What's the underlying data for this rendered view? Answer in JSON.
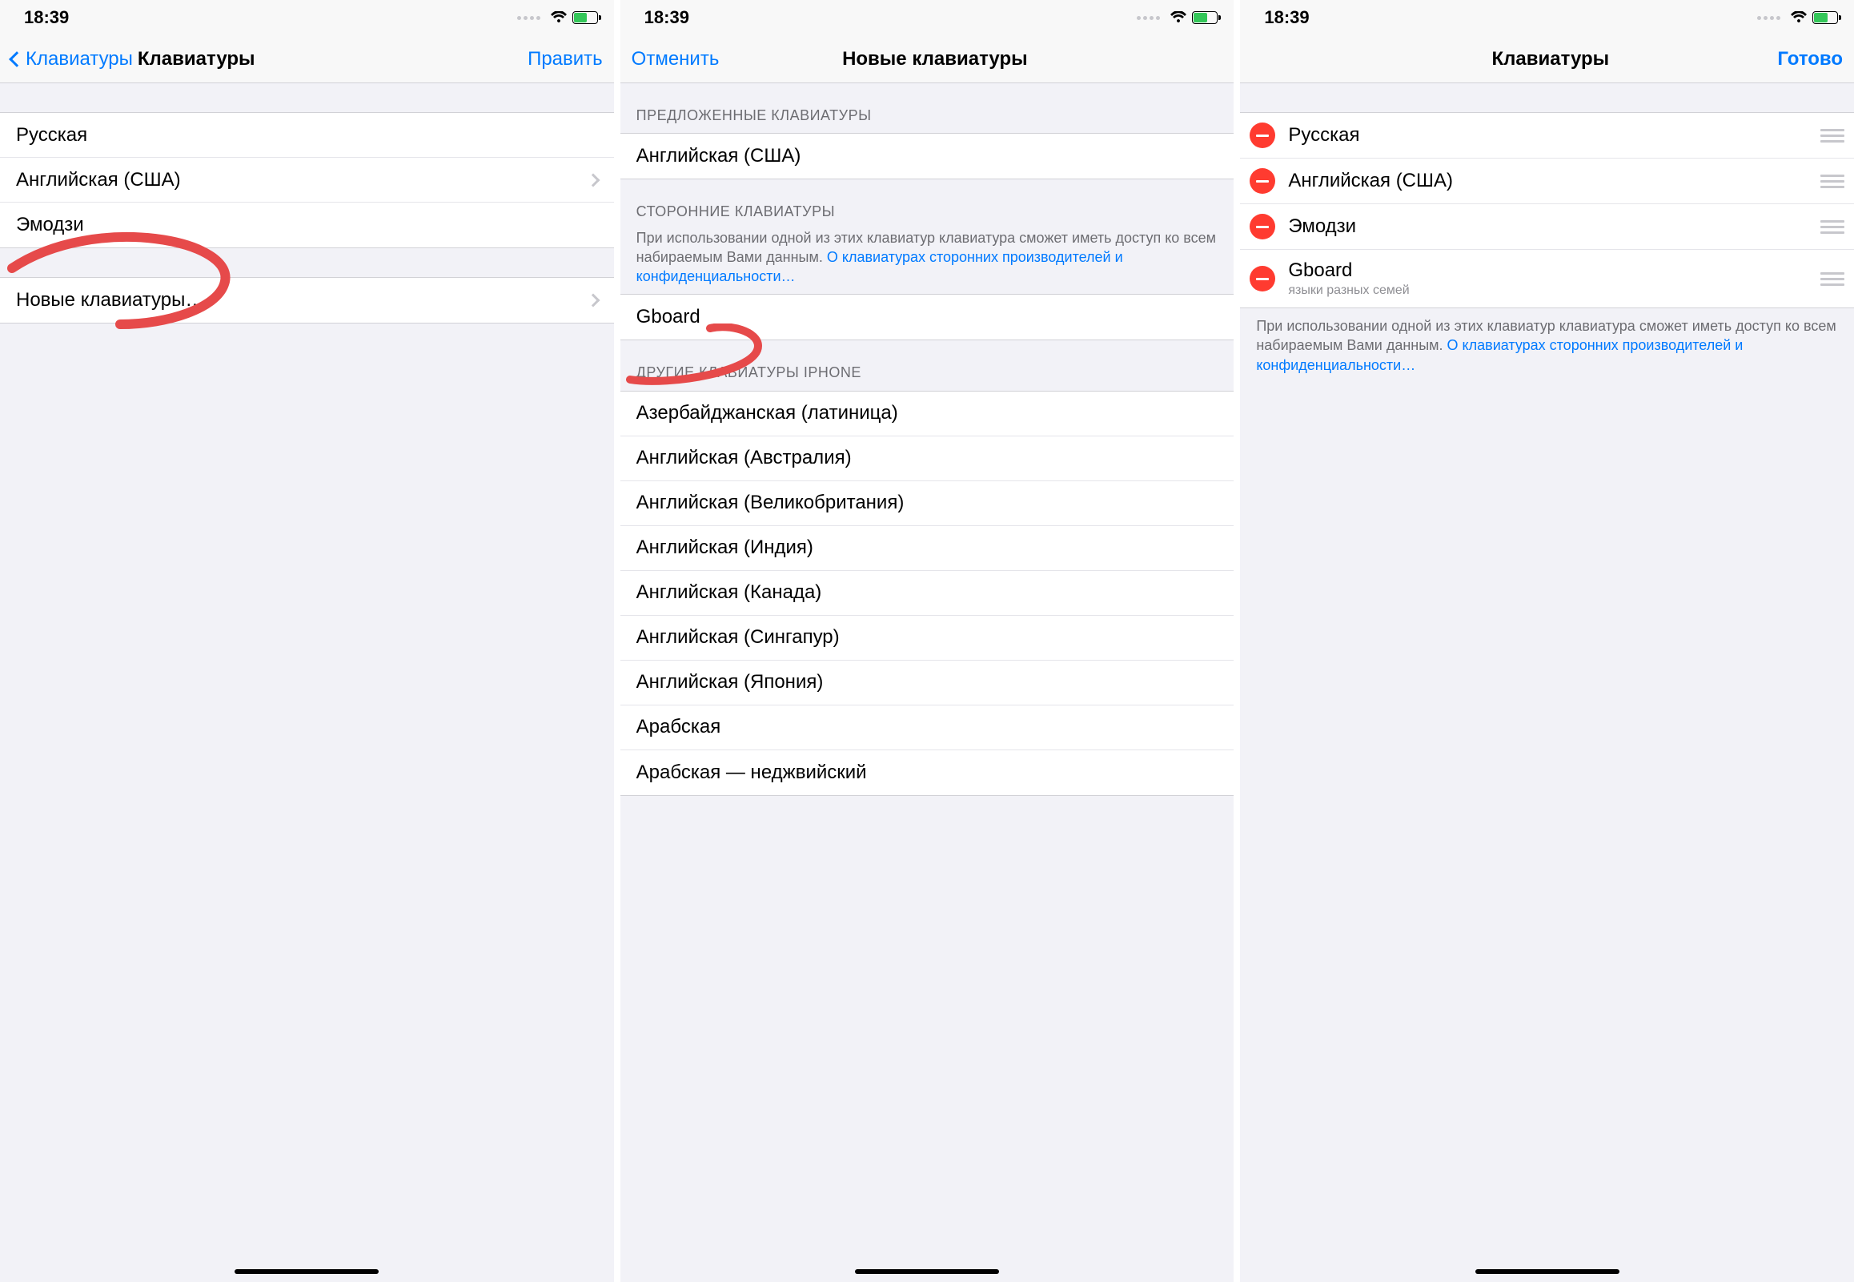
{
  "status": {
    "time": "18:39"
  },
  "screen1": {
    "nav_back": "Клавиатуры",
    "nav_title": "Клавиатуры",
    "nav_right": "Править",
    "rows": [
      "Русская",
      "Английская (США)",
      "Эмодзи"
    ],
    "add_row": "Новые клавиатуры…"
  },
  "screen2": {
    "nav_cancel": "Отменить",
    "nav_title": "Новые клавиатуры",
    "sections": {
      "suggested": {
        "header": "ПРЕДЛОЖЕННЫЕ КЛАВИАТУРЫ",
        "rows": [
          "Английская (США)"
        ]
      },
      "third_party": {
        "header": "СТОРОННИЕ КЛАВИАТУРЫ",
        "footer_text": "При использовании одной из этих клавиатур клавиатура сможет иметь доступ ко всем набираемым Вами данным. ",
        "footer_link": "О клавиатурах сторонних производителей и конфиденциальности…",
        "rows": [
          "Gboard"
        ]
      },
      "other": {
        "header": "ДРУГИЕ КЛАВИАТУРЫ IPHONE",
        "rows": [
          "Азербайджанская (латиница)",
          "Английская (Австралия)",
          "Английская (Великобритания)",
          "Английская (Индия)",
          "Английская (Канада)",
          "Английская (Сингапур)",
          "Английская (Япония)",
          "Арабская",
          "Арабская — неджвийский"
        ]
      }
    }
  },
  "screen3": {
    "nav_title": "Клавиатуры",
    "nav_right": "Готово",
    "rows": [
      {
        "title": "Русская",
        "sub": ""
      },
      {
        "title": "Английская (США)",
        "sub": ""
      },
      {
        "title": "Эмодзи",
        "sub": ""
      },
      {
        "title": "Gboard",
        "sub": "языки разных семей"
      }
    ],
    "footer_text": "При использовании одной из этих клавиатур клавиатура сможет иметь доступ ко всем набираемым Вами данным. ",
    "footer_link": "О клавиатурах сторонних производителей и конфиденциальности…"
  }
}
